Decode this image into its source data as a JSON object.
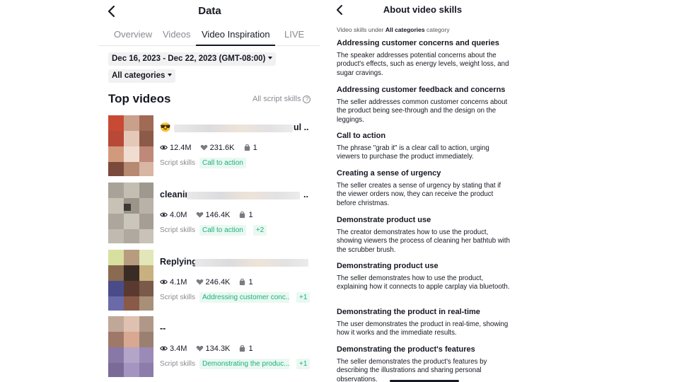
{
  "left": {
    "title": "Data",
    "tabs": [
      "Overview",
      "Videos",
      "Video Inspiration",
      "LIVE"
    ],
    "active_tab": "Video Inspiration",
    "date_range": "Dec 16, 2023 - Dec 22, 2023 (GMT-08:00)",
    "category": "All categories",
    "section_title": "Top videos",
    "script_skills_link": "All script skills",
    "script_skills_label": "Script skills",
    "videos": [
      {
        "title": "😎",
        "title_tail": "ul ...",
        "views": "12.4M",
        "likes": "231.6K",
        "products": "1",
        "skills": [
          "Call to action"
        ],
        "more": ""
      },
      {
        "title": "cleanin",
        "title_tail": "..",
        "views": "4.0M",
        "likes": "146.4K",
        "products": "1",
        "skills": [
          "Call to action"
        ],
        "more": "+2"
      },
      {
        "title": "Replying",
        "title_tail": "",
        "views": "4.1M",
        "likes": "246.4K",
        "products": "1",
        "skills": [
          "Addressing customer conc..."
        ],
        "more": "+1"
      },
      {
        "title": "--",
        "title_tail": "",
        "views": "3.4M",
        "likes": "134.3K",
        "products": "1",
        "skills": [
          "Demonstrating the produc..."
        ],
        "more": "+1"
      }
    ]
  },
  "right": {
    "title": "About video skills",
    "category_note_prefix": "Video skills under",
    "category_note_bold": "All categories",
    "category_note_suffix": "category",
    "skills": [
      {
        "name": "Addressing customer concerns and queries",
        "desc": "The speaker addresses potential concerns about the product's effects, such as energy levels, weight loss, and sugar cravings."
      },
      {
        "name": "Addressing customer feedback and concerns",
        "desc": "The seller addresses common customer concerns about the product being see-through and the design on the leggings."
      },
      {
        "name": "Call to action",
        "desc": "The phrase \"grab it\" is a clear call to action, urging viewers to purchase the product immediately."
      },
      {
        "name": "Creating a sense of urgency",
        "desc": "The seller creates a sense of urgency by stating that if the viewer orders now, they can receive the product before christmas."
      },
      {
        "name": "Demonstrate product use",
        "desc": "The creator demonstrates how to use the product, showing viewers the process of cleaning her bathtub with the scrubber brush."
      },
      {
        "name": "Demonstrating product use",
        "desc": "The seller demonstrates how to use the product, explaining how it connects to apple carplay via bluetooth."
      },
      {
        "name": "Demonstrating the product in real-time",
        "desc": "The user demonstrates the product in real-time, showing how it works and the immediate results."
      },
      {
        "name": "Demonstrating the product's features",
        "desc": "The seller demonstrates the product's features by describing the illustrations and sharing personal observations."
      }
    ]
  },
  "colors": {
    "accent_green": "#1bb17d",
    "chip_bg": "#eaf8f2",
    "text": "#161823",
    "muted": "#8a8b91"
  },
  "icons": [
    "back-chevron-icon",
    "question-circle-icon",
    "eye-icon",
    "heart-icon",
    "bag-icon",
    "caret-down-icon"
  ]
}
